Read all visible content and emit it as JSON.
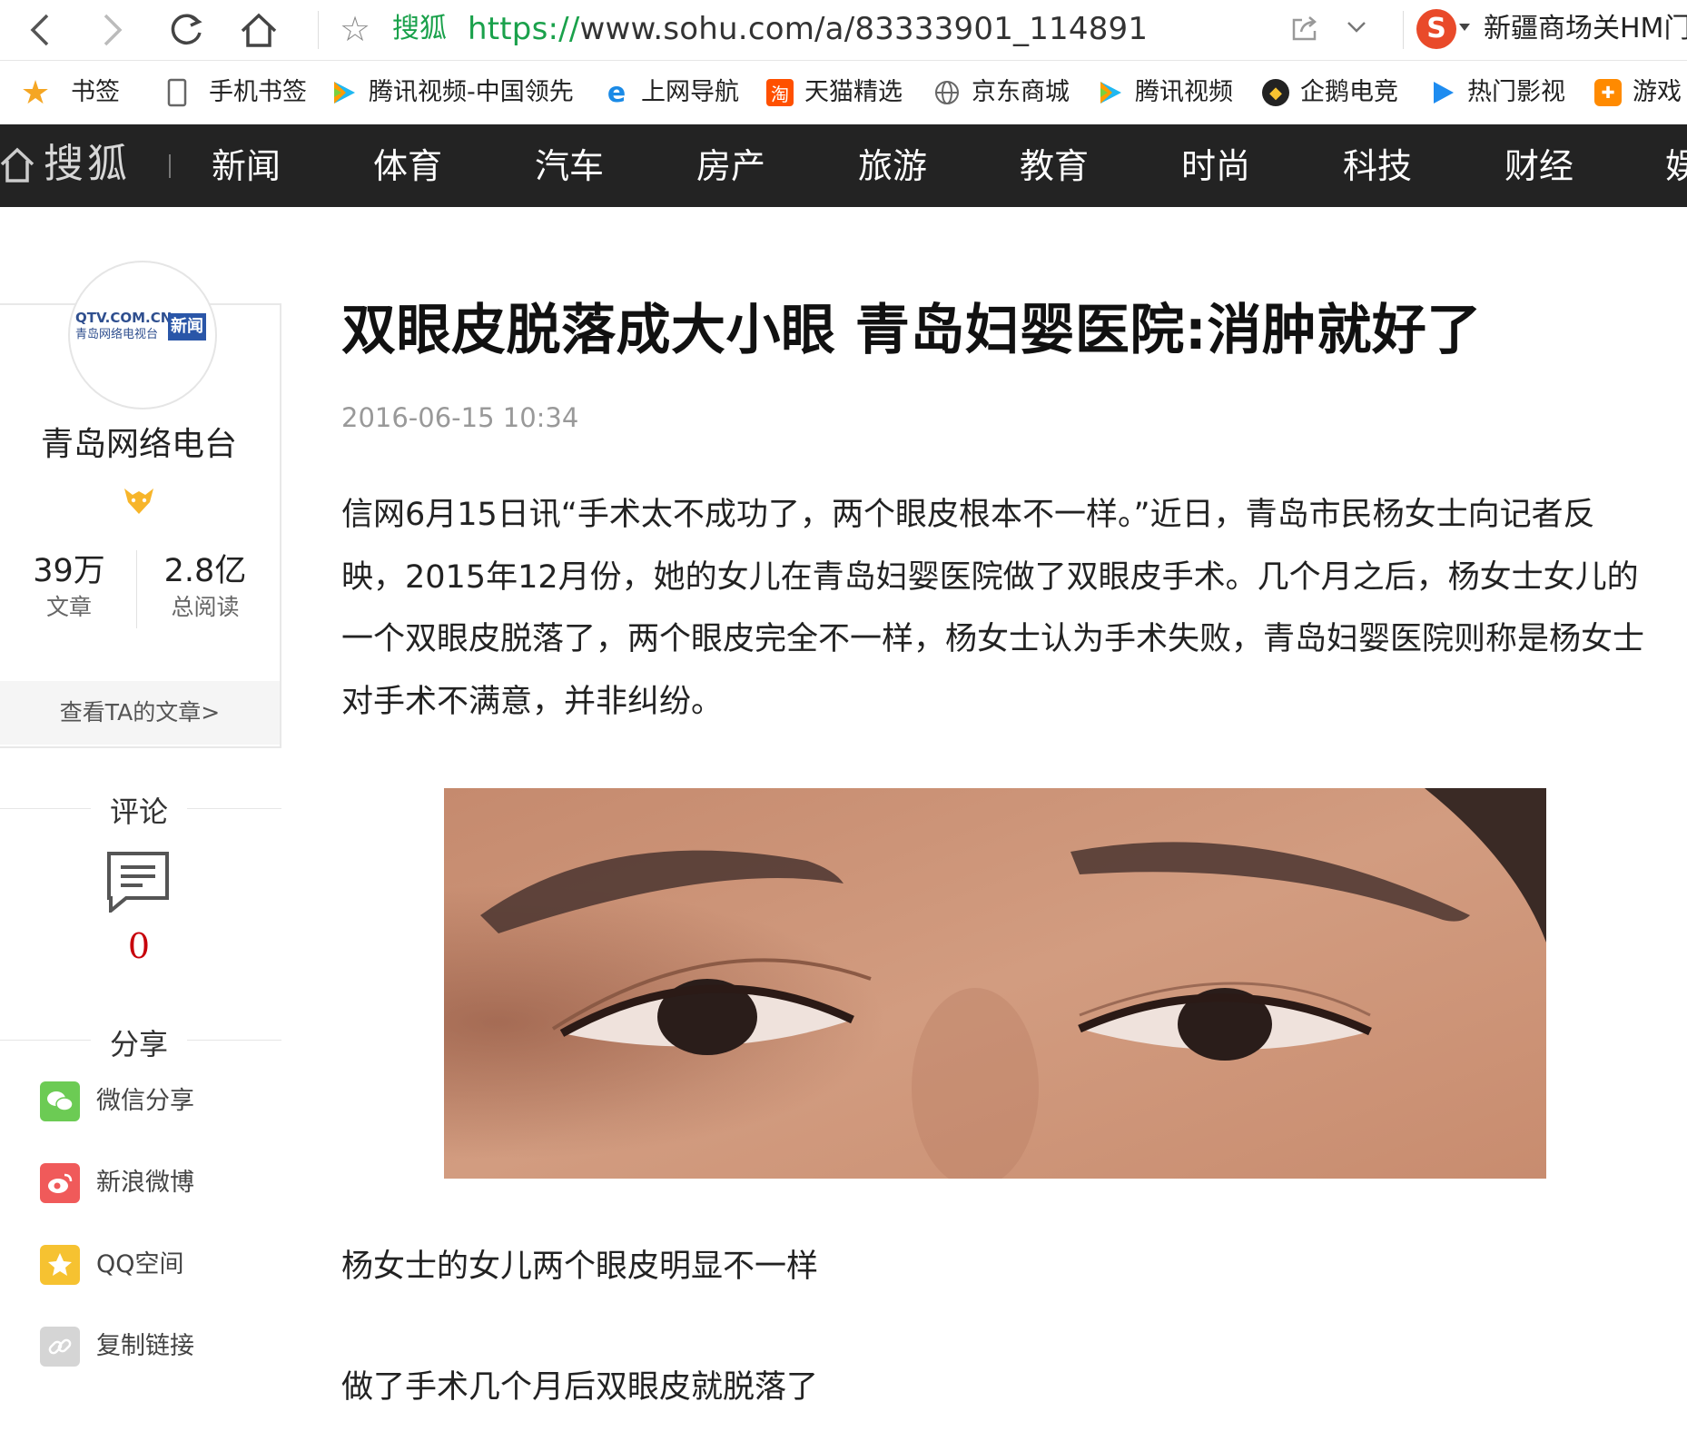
{
  "browser": {
    "site_name": "搜狐",
    "url_scheme": "https://",
    "url_rest": "www.sohu.com/a/83333901_114891",
    "search_text": "新疆商场关HM门"
  },
  "bookmarks": [
    {
      "label": "书签",
      "icon": "star-icon"
    },
    {
      "label": "手机书签",
      "icon": "phone-icon"
    },
    {
      "label": "腾讯视频-中国领先",
      "icon": "tencent-video-icon"
    },
    {
      "label": "上网导航",
      "icon": "ie-icon"
    },
    {
      "label": "天猫精选",
      "icon": "taobao-icon"
    },
    {
      "label": "京东商城",
      "icon": "globe-icon"
    },
    {
      "label": "腾讯视频",
      "icon": "tencent-video-icon"
    },
    {
      "label": "企鹅电竞",
      "icon": "penguin-esports-icon"
    },
    {
      "label": "热门影视",
      "icon": "play-icon"
    },
    {
      "label": "游戏",
      "icon": "gamepad-icon"
    }
  ],
  "sohu_nav": {
    "logo": "搜狐",
    "items": [
      "新闻",
      "体育",
      "汽车",
      "房产",
      "旅游",
      "教育",
      "时尚",
      "科技",
      "财经",
      "娱"
    ]
  },
  "author": {
    "avatar_text_1": "QTV.COM.CN",
    "avatar_text_2": "青岛网络电视台",
    "avatar_badge": "新闻",
    "name": "青岛网络电台",
    "articles_num": "39万",
    "articles_label": "文章",
    "reads_num": "2.8亿",
    "reads_label": "总阅读",
    "view_link": "查看TA的文章>"
  },
  "comments": {
    "title": "评论",
    "count": "0"
  },
  "share": {
    "title": "分享",
    "items": [
      {
        "label": "微信分享",
        "icon": "wechat-icon",
        "color": "#6ccb54"
      },
      {
        "label": "新浪微博",
        "icon": "weibo-icon",
        "color": "#f05a5a"
      },
      {
        "label": "QQ空间",
        "icon": "qzone-icon",
        "color": "#f6c231"
      },
      {
        "label": "复制链接",
        "icon": "link-icon",
        "color": "#d5d5d5"
      }
    ]
  },
  "article": {
    "title": "双眼皮脱落成大小眼 青岛妇婴医院:消肿就好了",
    "date": "2016-06-15 10:34",
    "body": "信网6月15日讯“手术太不成功了，两个眼皮根本不一样。”近日，青岛市民杨女士向记者反映，2015年12月份，她的女儿在青岛妇婴医院做了双眼皮手术。几个月之后，杨女士女儿的一个双眼皮脱落了，两个眼皮完全不一样，杨女士认为手术失败，青岛妇婴医院则称是杨女士对手术不满意，并非纠纷。",
    "caption_1": "杨女士的女儿两个眼皮明显不一样",
    "caption_2": "做了手术几个月后双眼皮就脱落了"
  },
  "colors": {
    "nav_bg": "#232323",
    "url_green": "#1aa14b",
    "comment_red": "#c7000b"
  }
}
